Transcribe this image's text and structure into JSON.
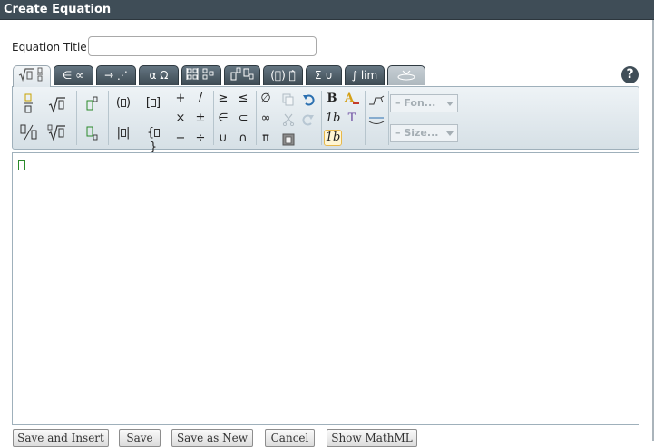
{
  "dialog": {
    "title": "Create Equation"
  },
  "equation_title": {
    "label": "Equation Title",
    "value": "",
    "placeholder": ""
  },
  "tabs": [
    {
      "label": "√⃞ ⁝",
      "name": "tab-fractions-roots",
      "active": true
    },
    {
      "label": "∈ ∞",
      "name": "tab-sets-infinity"
    },
    {
      "label": "→ ⋰",
      "name": "tab-arrows-dots"
    },
    {
      "label": "α Ω",
      "name": "tab-greek"
    },
    {
      "label": "⁞⁞ ⁝",
      "name": "tab-matrices"
    },
    {
      "label": "⎕ ⎕",
      "name": "tab-scripts"
    },
    {
      "label": "(⃞) ⃞̂",
      "name": "tab-brackets-accents"
    },
    {
      "label": "Σ ∪",
      "name": "tab-big-operators"
    },
    {
      "label": "∫ lim",
      "name": "tab-calculus"
    },
    {
      "label": "⌂",
      "name": "tab-extra",
      "disabled": true
    }
  ],
  "help": {
    "label": "?"
  },
  "toolbar": {
    "operators": [
      "+",
      "/",
      "×",
      "±",
      "−",
      "÷"
    ],
    "relations": [
      "≥",
      "≤",
      "∈",
      "⊂",
      "∪",
      "∩"
    ],
    "misc": [
      "∅",
      "∞",
      "π"
    ],
    "format_bold": "B",
    "format_italic": "1b",
    "format_upright": "1b",
    "text_tool": "T",
    "font_dropdown": "– Fon...",
    "size_dropdown": "– Size..."
  },
  "editor": {
    "placeholder": ""
  },
  "buttons": {
    "save_insert": "Save and Insert",
    "save": "Save",
    "save_new": "Save as New",
    "cancel": "Cancel",
    "show_mathml": "Show MathML"
  },
  "colors": {
    "titlebar": "#3f4d57",
    "tab_dark": "#3d4a53",
    "accent_undo": "#2a6fb0",
    "caret_box": "#2a8a2a",
    "text_color_icon": "#d4a017"
  }
}
